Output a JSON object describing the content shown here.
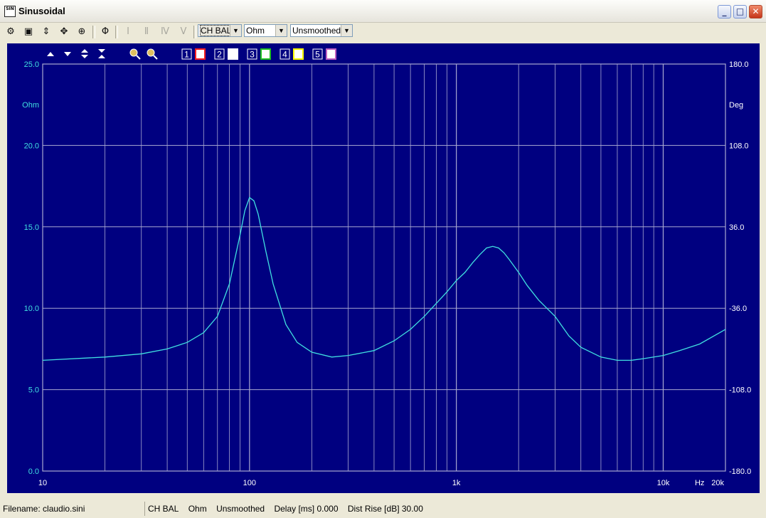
{
  "window": {
    "title": "Sinusoidal",
    "app_icon_text": "SIN"
  },
  "toolbar": {
    "icons": [
      "settings-icon",
      "save-icon",
      "marker-icon",
      "move-icon",
      "target-icon",
      "phase-icon",
      "roman-1-icon",
      "roman-2-icon",
      "roman-4-icon",
      "roman-5-icon"
    ],
    "channel": "CH BAL",
    "unit": "Ohm",
    "smoothing": "Unsmoothed"
  },
  "chart_toolbar": {
    "curve_slots": [
      {
        "number": "1",
        "color": "#ff2020"
      },
      {
        "number": "2",
        "color": "#ffffff"
      },
      {
        "number": "3",
        "color": "#20c020"
      },
      {
        "number": "4",
        "color": "#ffff00"
      },
      {
        "number": "5",
        "color": "#c060c0"
      }
    ]
  },
  "chart_data": {
    "type": "line",
    "x_scale": "log",
    "xlim": [
      10,
      20000
    ],
    "ylim": [
      0,
      25
    ],
    "y2lim": [
      -180,
      180
    ],
    "grid": true,
    "x_ticks": [
      {
        "value": 10,
        "label": "10"
      },
      {
        "value": 100,
        "label": "100"
      },
      {
        "value": 1000,
        "label": "1k"
      },
      {
        "value": 10000,
        "label": "10k"
      },
      {
        "value": 20000,
        "label": "20k"
      }
    ],
    "x_unit": "Hz",
    "y_ticks": [
      "0.0",
      "5.0",
      "10.0",
      "15.0",
      "20.0",
      "25.0"
    ],
    "y_unit": "Ohm",
    "y2_ticks": [
      "-180.0",
      "-108.0",
      "-36.0",
      "36.0",
      "108.0",
      "180.0"
    ],
    "y2_unit": "Deg",
    "series": [
      {
        "color": "#40e0e0",
        "x": [
          10,
          20,
          30,
          40,
          50,
          60,
          70,
          80,
          90,
          95,
          100,
          105,
          110,
          120,
          130,
          150,
          170,
          200,
          250,
          300,
          400,
          500,
          600,
          700,
          800,
          900,
          1000,
          1100,
          1200,
          1300,
          1400,
          1500,
          1600,
          1700,
          1800,
          2000,
          2200,
          2500,
          3000,
          3500,
          4000,
          5000,
          6000,
          7000,
          8000,
          10000,
          12000,
          15000,
          20000
        ],
        "y": [
          6.8,
          7.0,
          7.2,
          7.5,
          7.9,
          8.5,
          9.5,
          11.5,
          14.5,
          16.0,
          16.8,
          16.6,
          15.8,
          13.5,
          11.5,
          9.0,
          7.9,
          7.3,
          7.0,
          7.1,
          7.4,
          8.0,
          8.7,
          9.5,
          10.3,
          11.0,
          11.7,
          12.2,
          12.8,
          13.3,
          13.7,
          13.8,
          13.7,
          13.4,
          13.0,
          12.2,
          11.4,
          10.5,
          9.5,
          8.3,
          7.6,
          7.0,
          6.8,
          6.8,
          6.9,
          7.1,
          7.4,
          7.8,
          8.7
        ]
      }
    ]
  },
  "status": {
    "filename": "Filename: claudio.sini",
    "channel": "CH BAL",
    "unit": "Ohm",
    "smoothing": "Unsmoothed",
    "delay": "Delay [ms] 0.000",
    "dist_rise": "Dist Rise [dB] 30.00"
  }
}
